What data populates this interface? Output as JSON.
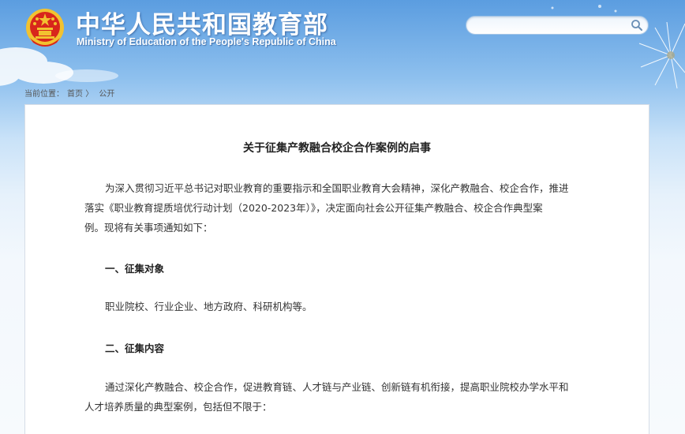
{
  "header": {
    "title": "中华人民共和国教育部",
    "subtitle": "Ministry of Education of the People's Republic of China"
  },
  "search": {
    "placeholder": "",
    "value": ""
  },
  "breadcrumb": {
    "prefix": "当前位置：",
    "home": "首页",
    "separator": "〉",
    "current": "公开"
  },
  "article": {
    "title": "关于征集产教融合校企合作案例的启事",
    "intro_line1": "为深入贯彻习近平总书记对职业教育的重要指示和全国职业教育大会精神，深化产教融合、校企合作，推进",
    "intro_line2": "落实《职业教育提质培优行动计划（2020-2023年）》，决定面向社会公开征集产教融合、校企合作典型案",
    "intro_line3": "例。现将有关事项通知如下：",
    "section1_heading": "一、征集对象",
    "section1_body": "职业院校、行业企业、地方政府、科研机构等。",
    "section2_heading": "二、征集内容",
    "section2_line1": "通过深化产教融合、校企合作，促进教育链、人才链与产业链、创新链有机衔接，提高职业院校办学水平和",
    "section2_line2": "人才培养质量的典型案例，包括但不限于："
  },
  "colors": {
    "sky_top": "#5b9de0",
    "emblem_red": "#d8261c",
    "emblem_gold": "#f2c230"
  },
  "icons": [
    "national-emblem-icon",
    "search-icon"
  ]
}
